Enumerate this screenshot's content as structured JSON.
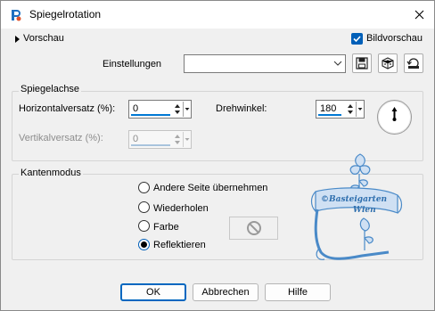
{
  "window": {
    "title": "Spiegelrotation"
  },
  "preview": {
    "label": "Vorschau",
    "image_preview_label": "Bildvorschau",
    "image_preview_checked": true
  },
  "settings": {
    "label": "Einstellungen",
    "value": ""
  },
  "mirror_axis": {
    "group_title": "Spiegelachse",
    "horizontal_label": "Horizontalversatz (%):",
    "horizontal_value": "0",
    "vertical_label": "Vertikalversatz (%):",
    "vertical_value": "0",
    "rotation_label": "Drehwinkel:",
    "rotation_value": "180"
  },
  "edge_mode": {
    "group_title": "Kantenmodus",
    "options": [
      "Andere Seite übernehmen",
      "Wiederholen",
      "Farbe",
      "Reflektieren"
    ],
    "selected": "Reflektieren"
  },
  "watermark": {
    "line1": "©Basteigarten",
    "line2": "Wien"
  },
  "buttons": {
    "ok": "OK",
    "cancel": "Abbrechen",
    "help": "Hilfe"
  },
  "colors": {
    "accent": "#0067c0",
    "check": "#005fb8",
    "watermark": "#4a8ac8"
  },
  "icons": [
    "app-icon",
    "close-icon",
    "expand-arrow-icon",
    "checkbox-check-icon",
    "chevron-down-icon",
    "save-icon",
    "randomize-icon",
    "reset-icon",
    "rotation-dial-icon",
    "no-color-icon"
  ]
}
